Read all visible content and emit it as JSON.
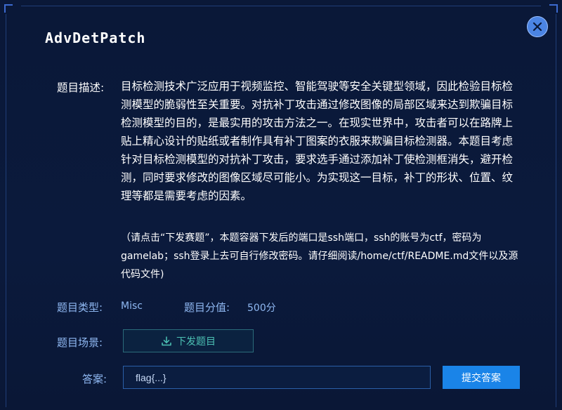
{
  "dialog": {
    "title": "AdvDetPatch",
    "close_icon": "close-icon"
  },
  "challenge": {
    "description_label": "题目描述:",
    "description": "目标检测技术广泛应用于视频监控、智能驾驶等安全关键型领域，因此检验目标检测模型的脆弱性至关重要。对抗补丁攻击通过修改图像的局部区域来达到欺骗目标检测模型的目的，是最实用的攻击方法之一。在现实世界中，攻击者可以在路牌上贴上精心设计的贴纸或者制作具有补丁图案的衣服来欺骗目标检测器。本题目考虑针对目标检测模型的对抗补丁攻击，要求选手通过添加补丁使检测框消失，避开检测，同时要求修改的图像区域尽可能小。为实现这一目标，补丁的形状、位置、纹理等都是需要考虑的因素。",
    "note": "（请点击“下发赛题”，本题容器下发后的端口是ssh端口，ssh的账号为ctf，密码为gamelab；ssh登录上去可自行修改密码。请仔细阅读/home/ctf/README.md文件以及源代码文件)",
    "type_label": "题目类型:",
    "type_value": "Misc",
    "score_label": "题目分值:",
    "score_value": "500分",
    "scene_label": "题目场景:",
    "download_label": "下发题目",
    "download_icon": "download-icon"
  },
  "answer": {
    "label": "答案:",
    "placeholder": "flag{...}",
    "value": "",
    "submit_label": "提交答案"
  },
  "colors": {
    "background": "#0a1838",
    "accent": "#1a84e8",
    "label": "#8fb8f2",
    "download": "#4cc1b4"
  }
}
